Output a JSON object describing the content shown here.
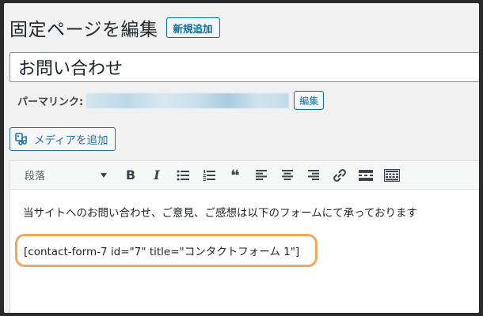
{
  "header": {
    "title": "固定ページを編集",
    "new_button": "新規追加"
  },
  "title_field": {
    "value": "お問い合わせ"
  },
  "permalink": {
    "label": "パーマリンク:",
    "edit_button": "編集"
  },
  "media_button": {
    "label": "メディアを追加",
    "icon": "add-media-icon"
  },
  "toolbar": {
    "format_select": "段落",
    "buttons": [
      "bold",
      "italic",
      "bulleted-list",
      "numbered-list",
      "blockquote",
      "align-left",
      "align-center",
      "align-right",
      "insert-link",
      "read-more",
      "toolbar-toggle"
    ],
    "bold_label": "B",
    "italic_label": "I",
    "quote_label": "❝"
  },
  "content": {
    "paragraph": "当サイトへのお問い合わせ、ご意見、ご感想は以下のフォームにて承っております",
    "shortcode": "[contact-form-7 id=\"7\" title=\"コンタクトフォーム 1\"]"
  },
  "colors": {
    "accent": "#0071a1",
    "highlight_outline": "#f2a65a"
  }
}
